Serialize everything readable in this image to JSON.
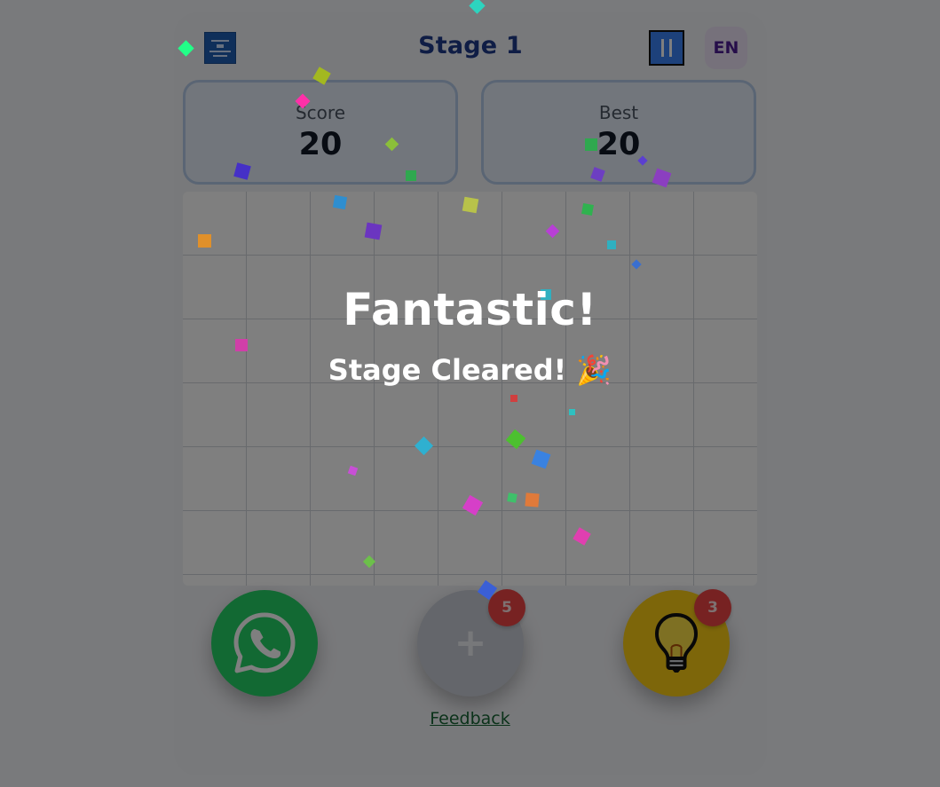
{
  "header": {
    "stage_title": "Stage 1",
    "language": "EN"
  },
  "scores": {
    "score_label": "Score",
    "score_value": "20",
    "best_label": "Best",
    "best_value": "20"
  },
  "actions": {
    "add_badge": "5",
    "add_symbol": "+",
    "hint_badge": "3",
    "feedback_label": "Feedback"
  },
  "overlay": {
    "title": "Fantastic!",
    "subtitle": "Stage Cleared! 🎉"
  },
  "icons": {
    "logo": "logo-icon",
    "pause": "pause-icon",
    "whatsapp": "whatsapp-icon",
    "add": "plus-icon",
    "hint": "lightbulb-icon"
  },
  "colors": {
    "title": "#1e3a8a",
    "whatsapp": "#25d366",
    "hint": "#facc15",
    "badge": "#ef4444",
    "feedback": "#166534",
    "pause": "#3b82f6"
  }
}
